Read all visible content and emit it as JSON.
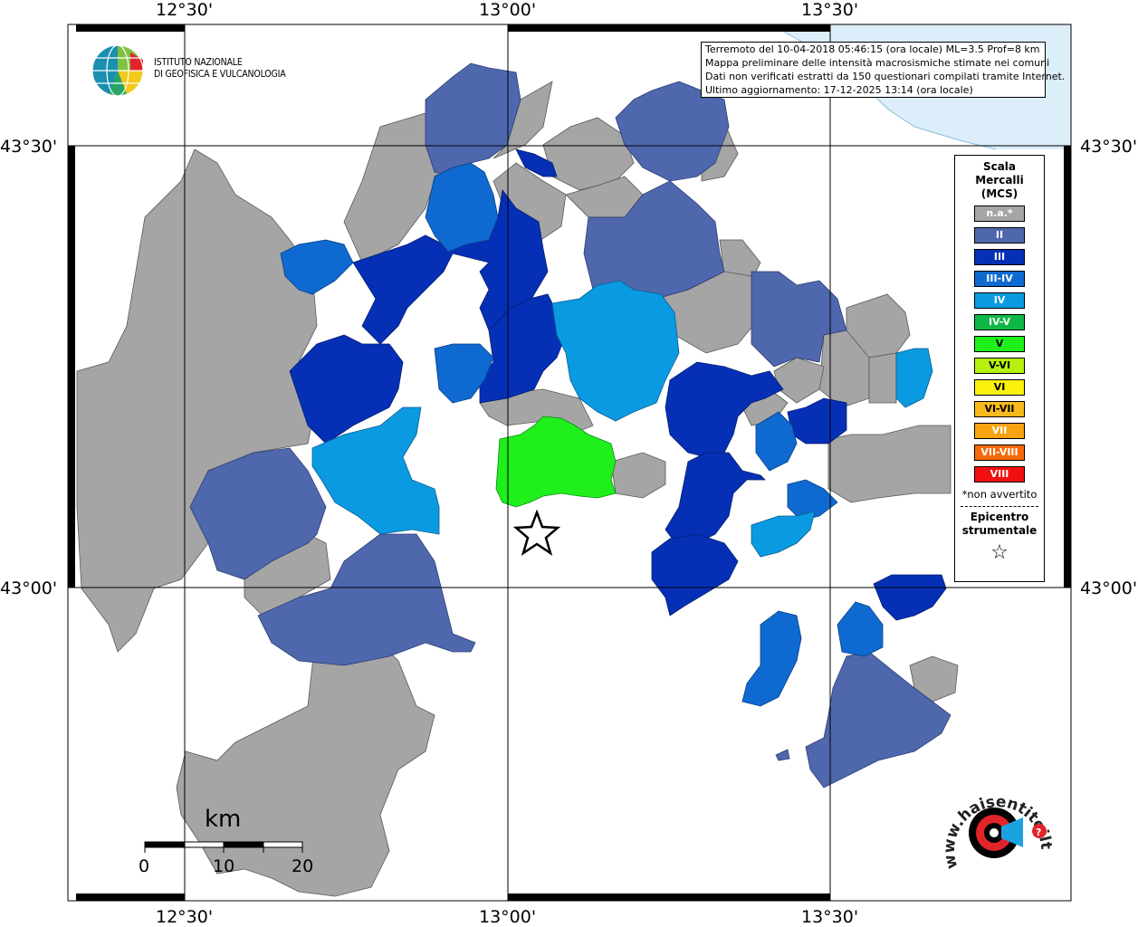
{
  "grid_labels": {
    "lon": [
      "12°30'",
      "13°00'",
      "13°30'"
    ],
    "lat": [
      "43°30'",
      "43°00'"
    ]
  },
  "info": {
    "line1": "Terremoto del 10-04-2018 05:46:15 (ora locale) ML=3.5 Prof=8 km",
    "line2": "Mappa preliminare delle intensità macrosismiche stimate nei comuni",
    "line3": "Dati non verificati estratti da 150 questionari compilati tramite Internet.",
    "line4": "Ultimo aggiornamento: 17-12-2025 13:14 (ora locale)"
  },
  "legend": {
    "title_lines": [
      "Scala",
      "Mercalli",
      "(MCS)"
    ],
    "items": [
      {
        "label": "n.a.*",
        "color": "#a5a5a5"
      },
      {
        "label": "II",
        "color": "#4f67ad"
      },
      {
        "label": "III",
        "color": "#0530b6"
      },
      {
        "label": "III-IV",
        "color": "#0e6ad0"
      },
      {
        "label": "IV",
        "color": "#0a9ae2"
      },
      {
        "label": "IV-V",
        "color": "#0fb845"
      },
      {
        "label": "V",
        "color": "#1ff01b"
      },
      {
        "label": "V-VI",
        "color": "#b6f00f"
      },
      {
        "label": "VI",
        "color": "#f9f00c"
      },
      {
        "label": "VI-VII",
        "color": "#f7b91c"
      },
      {
        "label": "VII",
        "color": "#f7a30f"
      },
      {
        "label": "VII-VIII",
        "color": "#f76a0a"
      },
      {
        "label": "VIII",
        "color": "#f20f0f"
      }
    ],
    "note": "*non avvertito",
    "epicenter_lines": [
      "Epicentro",
      "strumentale"
    ]
  },
  "ingv": {
    "line1": "ISTITUTO NAZIONALE",
    "line2": "DI GEOFISICA E VULCANOLOGIA"
  },
  "scale": {
    "unit": "km",
    "labels": [
      "0",
      "10",
      "20"
    ]
  },
  "logo_text": "www.haisentitoilterremoto.it"
}
